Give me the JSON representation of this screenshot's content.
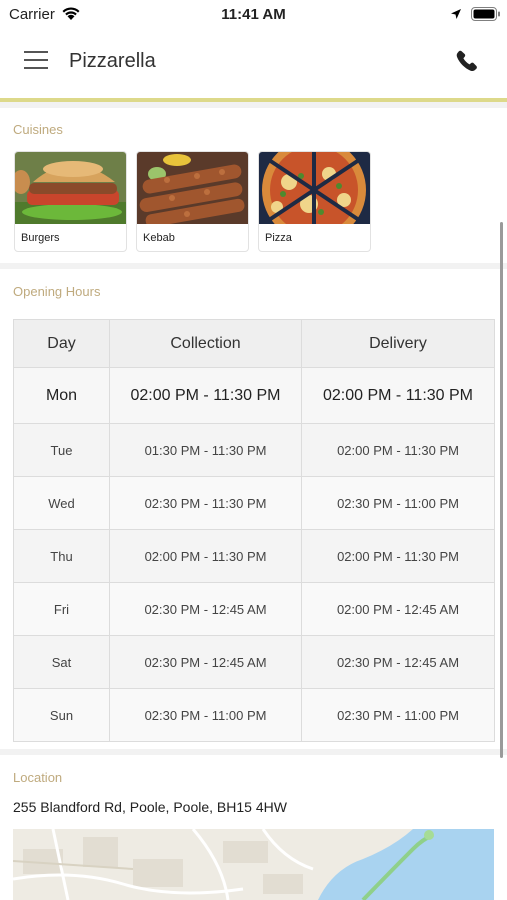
{
  "status_bar": {
    "carrier": "Carrier",
    "time": "11:41 AM"
  },
  "header": {
    "title": "Pizzarella"
  },
  "cuisines": {
    "heading": "Cuisines",
    "items": [
      {
        "label": "Burgers"
      },
      {
        "label": "Kebab"
      },
      {
        "label": "Pizza"
      }
    ]
  },
  "opening_hours": {
    "heading": "Opening Hours",
    "columns": [
      "Day",
      "Collection",
      "Delivery"
    ],
    "rows": [
      {
        "day": "Mon",
        "collection": "02:00 PM - 11:30 PM",
        "delivery": "02:00 PM - 11:30 PM"
      },
      {
        "day": "Tue",
        "collection": "01:30 PM - 11:30 PM",
        "delivery": "02:00 PM - 11:30 PM"
      },
      {
        "day": "Wed",
        "collection": "02:30 PM - 11:30 PM",
        "delivery": "02:30 PM - 11:00 PM"
      },
      {
        "day": "Thu",
        "collection": "02:00 PM - 11:30 PM",
        "delivery": "02:00 PM - 11:30 PM"
      },
      {
        "day": "Fri",
        "collection": "02:30 PM - 12:45 AM",
        "delivery": "02:00 PM - 12:45 AM"
      },
      {
        "day": "Sat",
        "collection": "02:30 PM - 12:45 AM",
        "delivery": "02:30 PM - 12:45 AM"
      },
      {
        "day": "Sun",
        "collection": "02:30 PM - 11:00 PM",
        "delivery": "02:30 PM - 11:00 PM"
      }
    ]
  },
  "location": {
    "heading": "Location",
    "address": "255 Blandford Rd, Poole, Poole, BH15 4HW"
  },
  "colors": {
    "accent": "#ddd98a",
    "section_heading": "#bfaa7e",
    "water": "#a9d3f0"
  }
}
